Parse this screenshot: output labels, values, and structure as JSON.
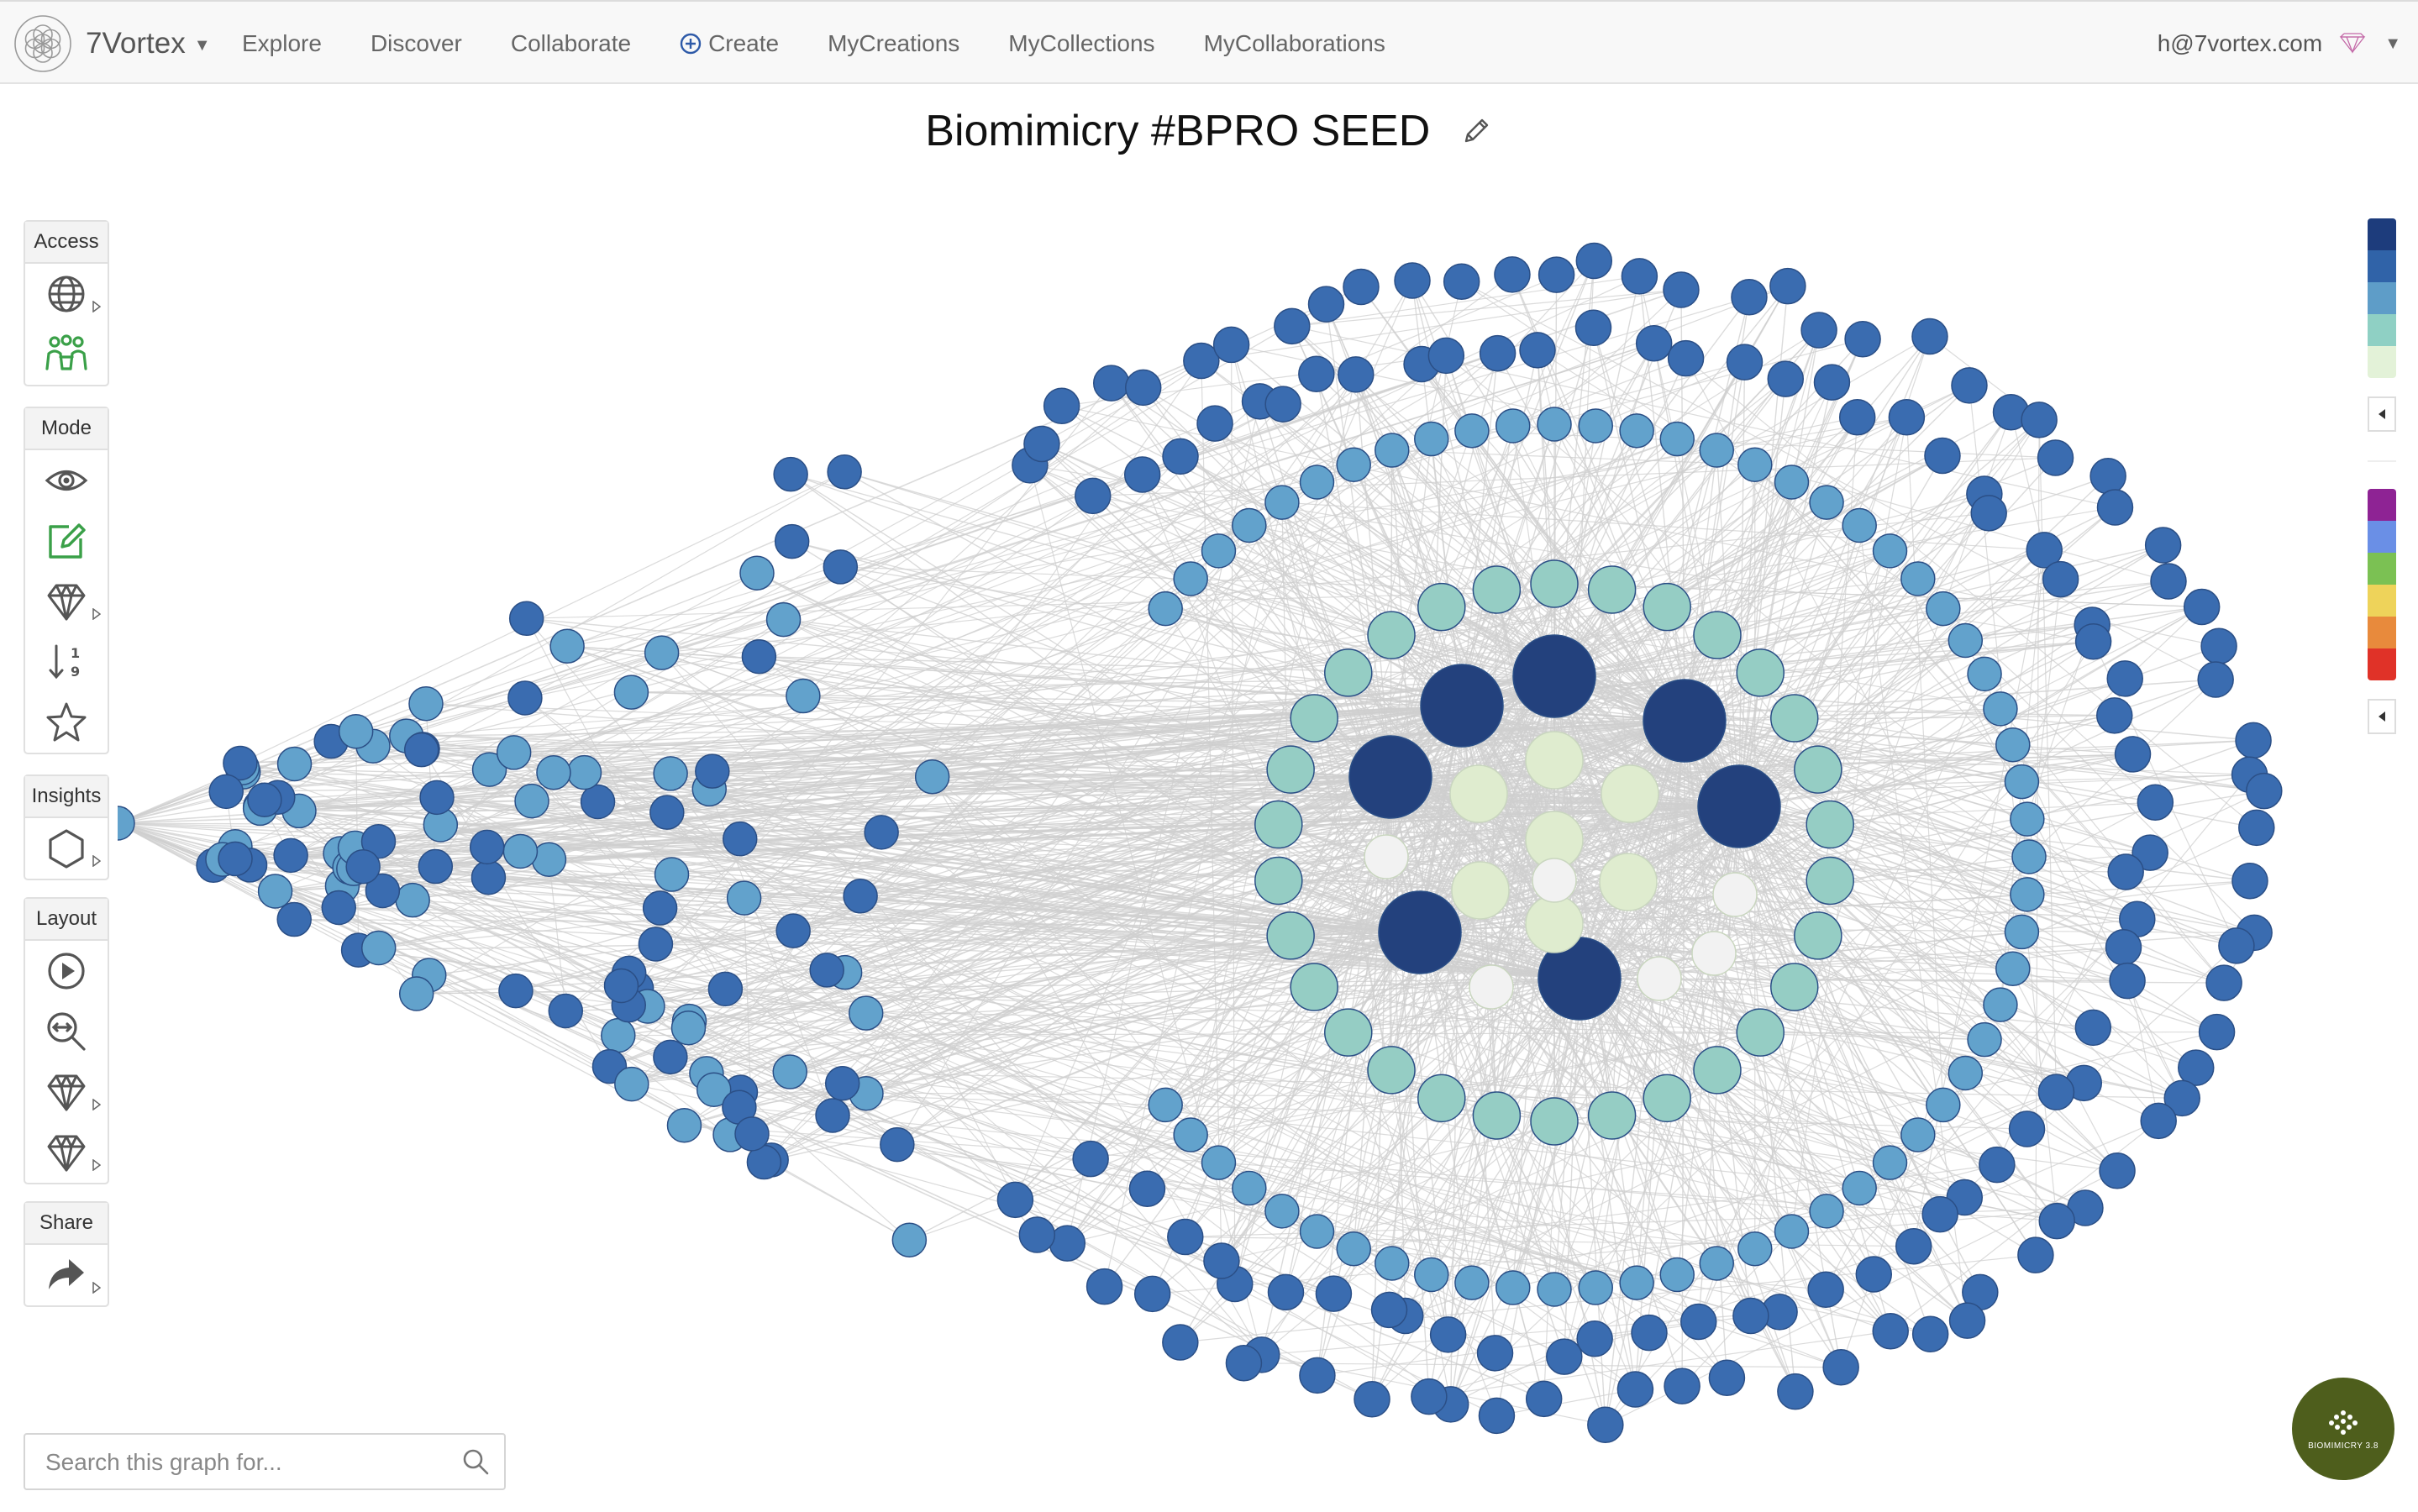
{
  "navbar": {
    "brand": "7Vortex",
    "items": [
      {
        "label": "Explore",
        "icon": ""
      },
      {
        "label": "Discover",
        "icon": ""
      },
      {
        "label": "Collaborate",
        "icon": ""
      },
      {
        "label": "Create",
        "icon": "plus-circle-icon"
      },
      {
        "label": "MyCreations",
        "icon": ""
      },
      {
        "label": "MyCollections",
        "icon": ""
      },
      {
        "label": "MyCollaborations",
        "icon": ""
      }
    ],
    "user_email": "h@7vortex.com"
  },
  "title": "Biomimicry #BPRO SEED",
  "panels": {
    "access": {
      "label": "Access",
      "tools": [
        "globe-icon",
        "group-collaborators-icon"
      ]
    },
    "mode": {
      "label": "Mode",
      "tools": [
        "eye-icon",
        "edit-icon",
        "diamond-icon",
        "sort-numeric-icon",
        "star-icon"
      ]
    },
    "insights": {
      "label": "Insights",
      "tools": [
        "hexagon-icon"
      ]
    },
    "layout": {
      "label": "Layout",
      "tools": [
        "play-icon",
        "zoom-fit-icon",
        "diamond-icon",
        "diamond-icon"
      ]
    },
    "share": {
      "label": "Share",
      "tools": [
        "share-arrow-icon"
      ]
    }
  },
  "legend": {
    "scale_colors": [
      "#1d3c7c",
      "#3063a8",
      "#5e9dc8",
      "#8fd0c4",
      "#e3f2d8"
    ],
    "category_colors": [
      "#8e2394",
      "#6a8fe6",
      "#7bc153",
      "#eed35a",
      "#e88a3c",
      "#e03228"
    ]
  },
  "search": {
    "placeholder": "Search this graph for..."
  },
  "badge": {
    "text": "BIOMIMICRY 3.8"
  },
  "colors": {
    "navy": "#23417d",
    "blue": "#3a6cb0",
    "lightblue": "#62a2cc",
    "teal": "#95cdc4",
    "pale": "#dfeccf",
    "white_node": "#f2f2f2",
    "edge": "#cfcfcf",
    "accent_green": "#3aa048"
  }
}
